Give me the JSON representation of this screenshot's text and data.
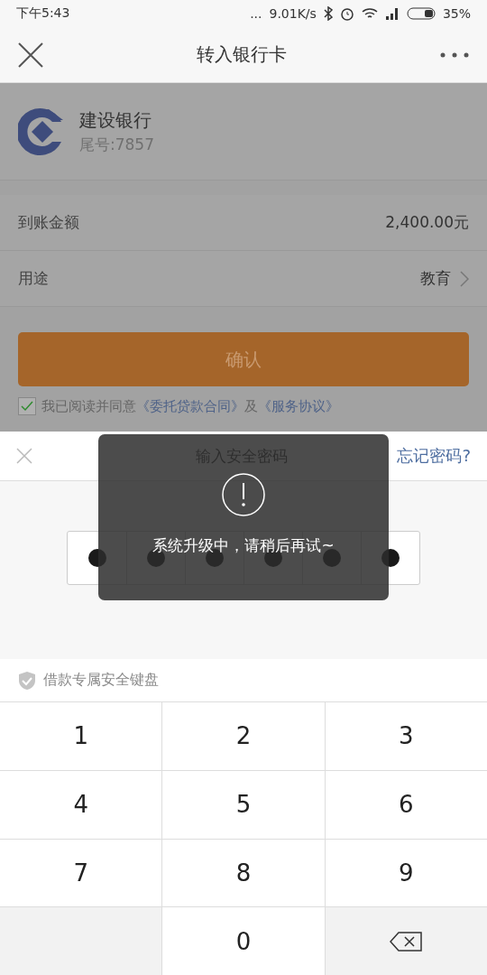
{
  "status_bar": {
    "time": "下午5:43",
    "more": "...",
    "speed": "9.01K/s",
    "battery": "35%"
  },
  "nav": {
    "title": "转入银行卡"
  },
  "bank": {
    "name": "建设银行",
    "tail": "尾号:7857"
  },
  "rows": [
    {
      "label": "到账金额",
      "value": "2,400.00元",
      "chevron": false
    },
    {
      "label": "用途",
      "value": "教育",
      "chevron": true
    }
  ],
  "confirm": {
    "label": "确认"
  },
  "agreement": {
    "checked": true,
    "text": "我已阅读并同意",
    "link1": "《委托贷款合同》",
    "and": "及",
    "link2": "《服务协议》"
  },
  "password_panel": {
    "title": "输入安全密码",
    "forgot": "忘记密码?",
    "cells": [
      {
        "filled": true
      },
      {
        "filled": true
      },
      {
        "filled": true
      },
      {
        "filled": true
      },
      {
        "filled": true
      },
      {
        "filled": true
      }
    ]
  },
  "toast": {
    "message": "系统升级中，请稍后再试~"
  },
  "keyboard": {
    "title": "借款专属安全键盘",
    "keys": [
      {
        "kind": "digit",
        "label": "1"
      },
      {
        "kind": "digit",
        "label": "2"
      },
      {
        "kind": "digit",
        "label": "3"
      },
      {
        "kind": "digit",
        "label": "4"
      },
      {
        "kind": "digit",
        "label": "5"
      },
      {
        "kind": "digit",
        "label": "6"
      },
      {
        "kind": "digit",
        "label": "7"
      },
      {
        "kind": "digit",
        "label": "8"
      },
      {
        "kind": "digit",
        "label": "9"
      },
      {
        "kind": "blank"
      },
      {
        "kind": "digit",
        "label": "0"
      },
      {
        "kind": "backspace"
      }
    ]
  }
}
